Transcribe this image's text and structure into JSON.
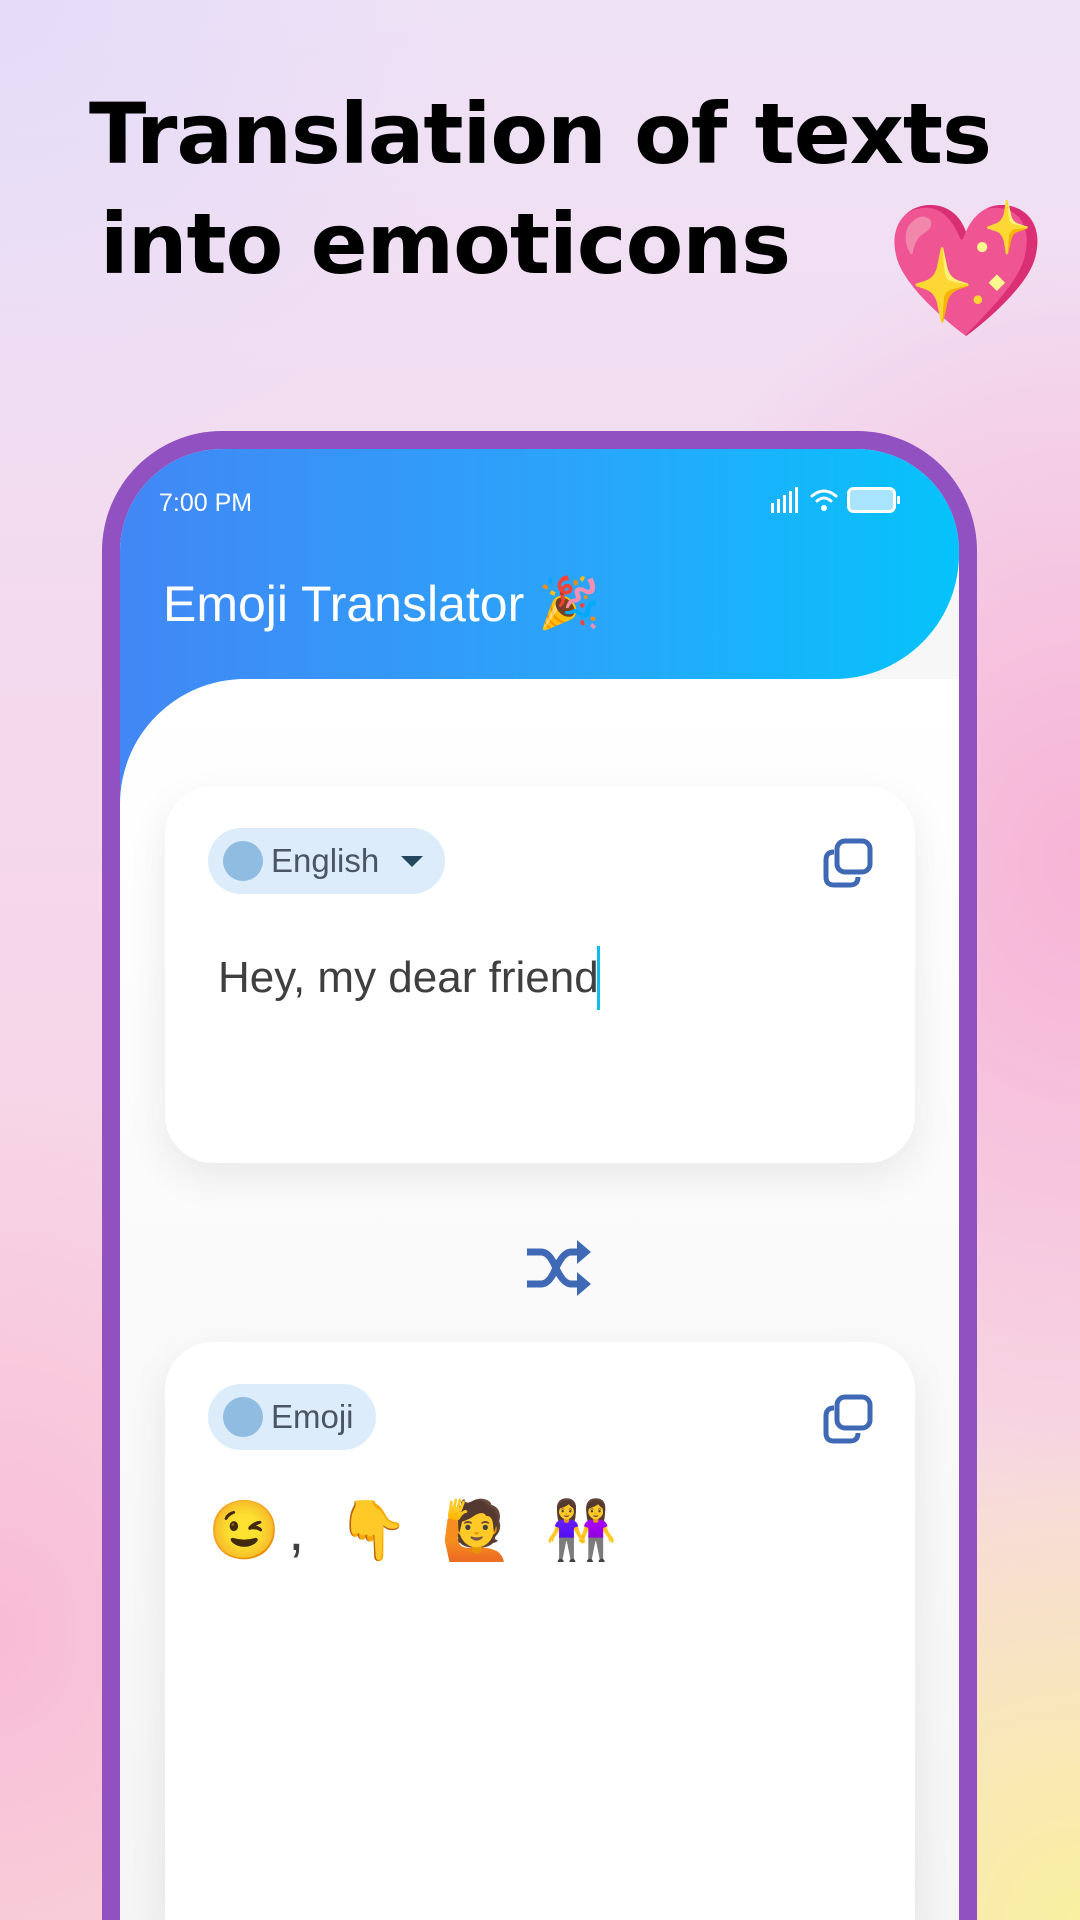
{
  "headline": {
    "line1": "Translation of texts",
    "line2": "into emoticons",
    "emoji": "💖"
  },
  "status_bar": {
    "time": "7:00 PM"
  },
  "app": {
    "title": "Emoji Translator",
    "title_emoji": "🎉",
    "accent": "#3f68b5",
    "frame": "#9151c1"
  },
  "source": {
    "language": "English",
    "text": "Hey, my dear friend"
  },
  "target": {
    "language": "Emoji",
    "text": "😉, 👇 🙋 👭"
  }
}
